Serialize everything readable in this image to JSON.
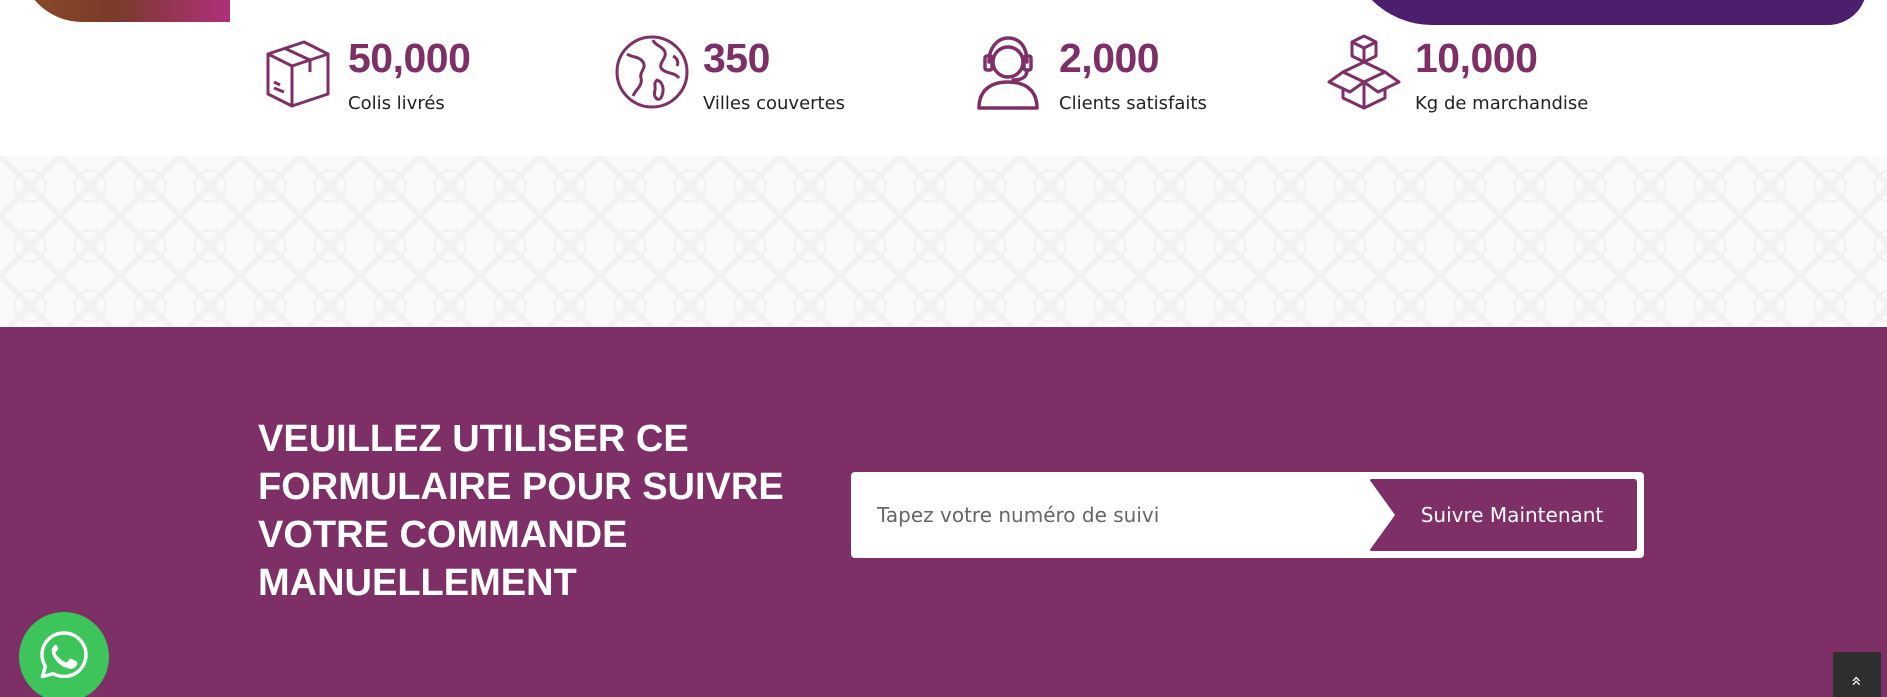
{
  "stats": [
    {
      "icon": "package-box-icon",
      "value": "50,000",
      "label": "Colis livrés"
    },
    {
      "icon": "globe-icon",
      "value": "350",
      "label": "Villes couvertes"
    },
    {
      "icon": "support-agent-icon",
      "value": "2,000",
      "label": "Clients satisfaits"
    },
    {
      "icon": "boxes-icon",
      "value": "10,000",
      "label": "Kg de marchandise"
    }
  ],
  "tracking": {
    "title": "VEUILLEZ UTILISER CE FORMULAIRE POUR SUIVRE VOTRE COMMANDE MANUELLEMENT",
    "input_placeholder": "Tapez votre numéro de suivi",
    "input_value": "",
    "button_label": "Suivre Maintenant"
  },
  "floating": {
    "whatsapp_icon": "whatsapp-icon",
    "back_to_top_icon": "double-chevron-up-icon",
    "back_to_top_glyph": "»"
  },
  "colors": {
    "accent": "#7e3066",
    "whatsapp": "#3dc45a",
    "back_to_top": "#2e2e2e"
  }
}
